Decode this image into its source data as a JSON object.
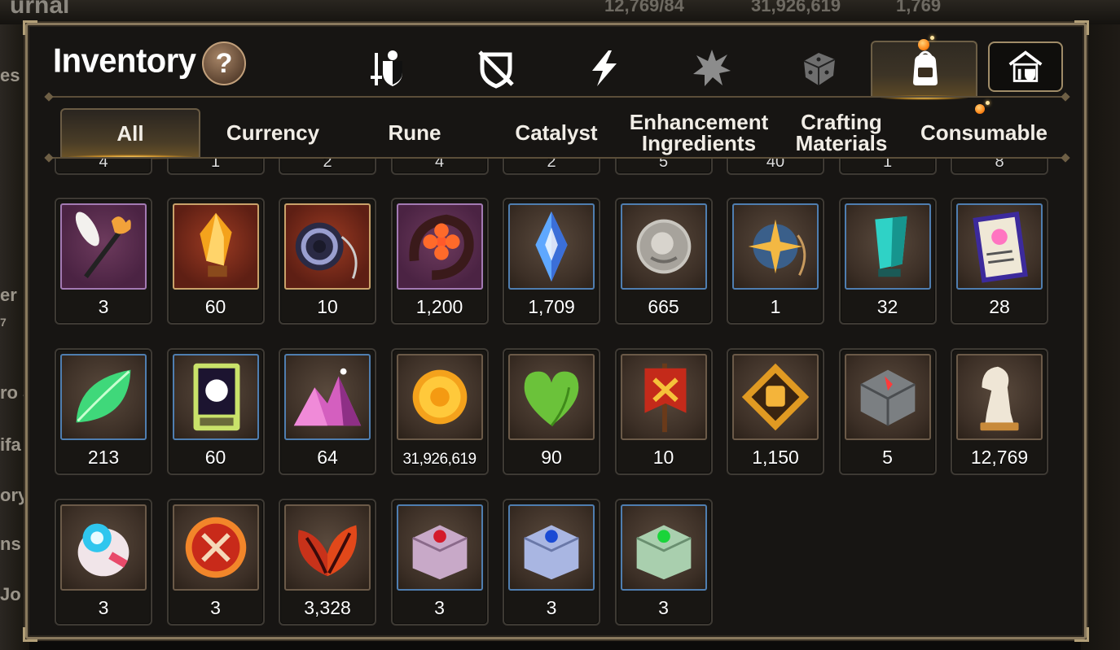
{
  "background": {
    "screen_title": "urnal",
    "left_labels": [
      "es",
      "er",
      "7",
      "ro J",
      "ifa",
      "ory",
      "ns",
      "Jo"
    ],
    "resources": [
      "12,769/84",
      "31,926,619",
      "1,769"
    ]
  },
  "modal": {
    "title": "Inventory",
    "help_label": "?"
  },
  "category_tabs": [
    {
      "id": "gear",
      "icon": "sword-shield-icon"
    },
    {
      "id": "unequipped",
      "icon": "crossed-shield-icon"
    },
    {
      "id": "skill",
      "icon": "lightning-icon"
    },
    {
      "id": "relic",
      "icon": "burst-icon"
    },
    {
      "id": "dice",
      "icon": "dice-icon"
    },
    {
      "id": "bag",
      "icon": "bag-icon",
      "active": true
    },
    {
      "id": "house",
      "icon": "house-icon"
    }
  ],
  "sub_tabs": [
    {
      "label": "All",
      "active": true
    },
    {
      "label": "Currency"
    },
    {
      "label": "Rune"
    },
    {
      "label": "Catalyst"
    },
    {
      "label": "Enhancement\nIngredients"
    },
    {
      "label": "Crafting\nMaterials"
    },
    {
      "label": "Consumable"
    }
  ],
  "partial_row_counts": [
    "4",
    "1",
    "2",
    "4",
    "2",
    "5",
    "40",
    "1",
    "8"
  ],
  "items": [
    {
      "icon": "feather-wand-icon",
      "frame": "purple",
      "count": "3"
    },
    {
      "icon": "amber-crystal-icon",
      "frame": "orange",
      "count": "60"
    },
    {
      "icon": "ring-pendant-icon",
      "frame": "orange",
      "count": "10"
    },
    {
      "icon": "flower-ring-icon",
      "frame": "purple",
      "count": "1,200"
    },
    {
      "icon": "blue-gem-icon",
      "frame": "blue",
      "count": "1,709"
    },
    {
      "icon": "silver-coin-icon",
      "frame": "blue",
      "count": "665"
    },
    {
      "icon": "star-amulet-icon",
      "frame": "blue",
      "count": "1"
    },
    {
      "icon": "teal-crystal-icon",
      "frame": "blue",
      "count": "32"
    },
    {
      "icon": "certificate-icon",
      "frame": "blue",
      "count": "28"
    },
    {
      "icon": "leaf-icon",
      "frame": "blue",
      "count": "213"
    },
    {
      "icon": "card-icon",
      "frame": "blue",
      "count": "60"
    },
    {
      "icon": "pink-crystal-pile-icon",
      "frame": "blue",
      "count": "64"
    },
    {
      "icon": "gold-coin-icon",
      "frame": "plain",
      "count": "31,926,619"
    },
    {
      "icon": "heart-icon",
      "frame": "plain",
      "count": "90"
    },
    {
      "icon": "banner-icon",
      "frame": "plain",
      "count": "10"
    },
    {
      "icon": "fist-emblem-icon",
      "frame": "plain",
      "count": "1,150"
    },
    {
      "icon": "stone-cube-icon",
      "frame": "plain",
      "count": "5"
    },
    {
      "icon": "chess-knight-icon",
      "frame": "plain",
      "count": "12,769"
    },
    {
      "icon": "egg-gadget-icon",
      "frame": "plain",
      "count": "3"
    },
    {
      "icon": "red-badge-icon",
      "frame": "plain",
      "count": "3"
    },
    {
      "icon": "red-leaves-icon",
      "frame": "plain",
      "count": "3,328"
    },
    {
      "icon": "purple-chest-icon",
      "frame": "blue",
      "count": "3"
    },
    {
      "icon": "blue-chest-icon",
      "frame": "blue",
      "count": "3"
    },
    {
      "icon": "green-chest-icon",
      "frame": "blue",
      "count": "3"
    }
  ]
}
